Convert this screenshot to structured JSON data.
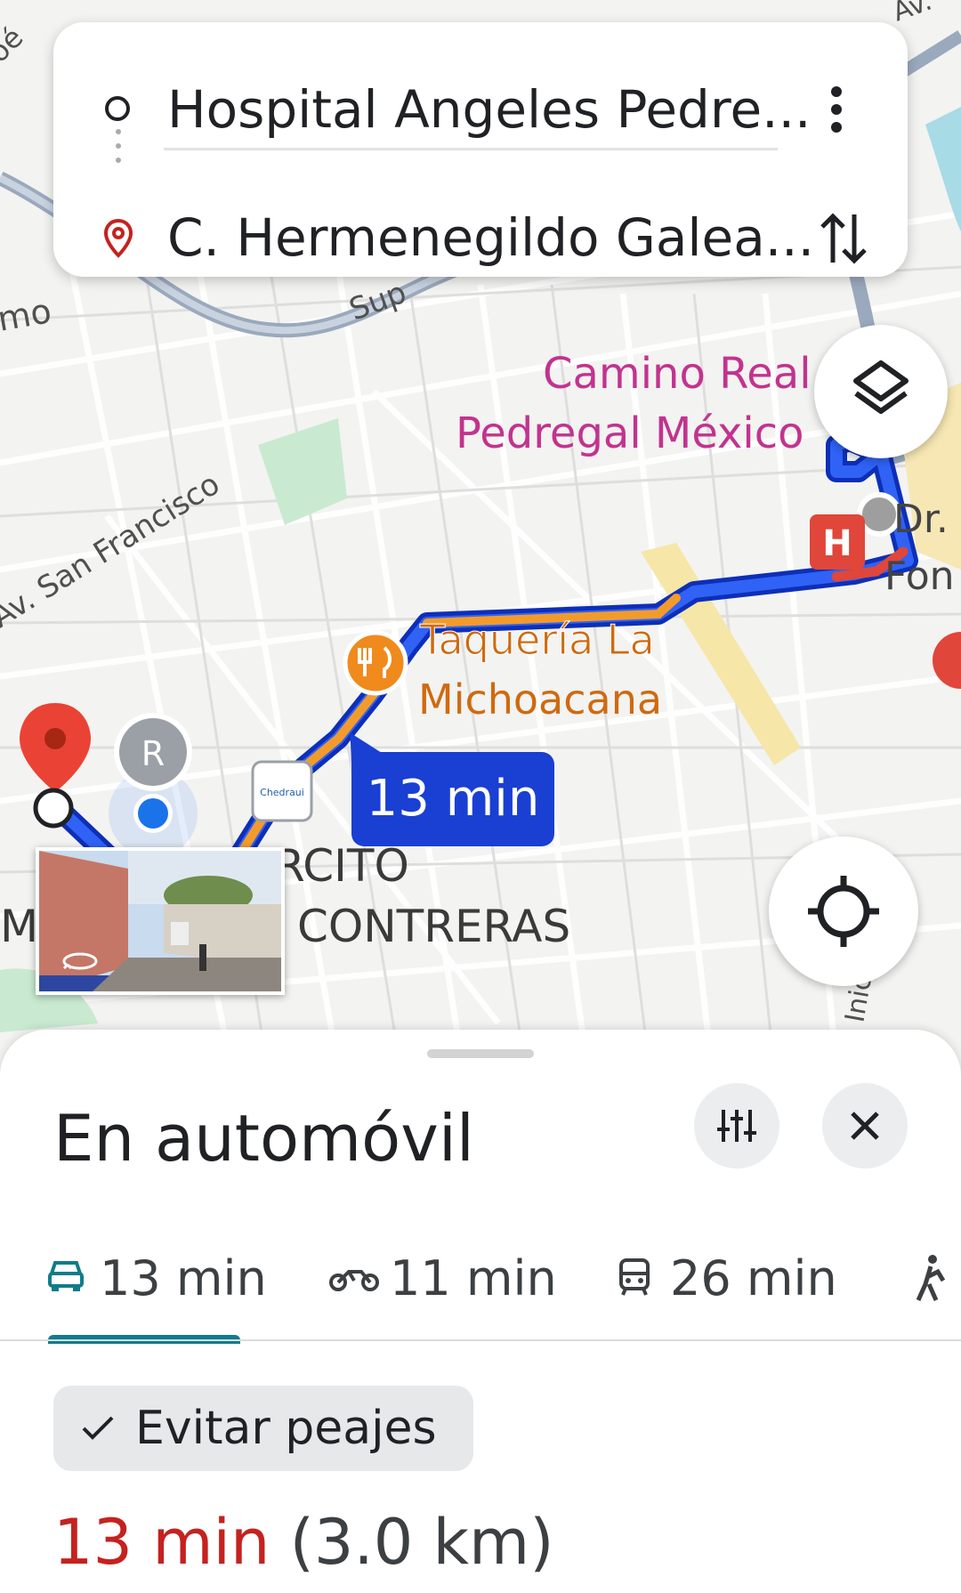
{
  "search": {
    "origin": "Hospital Angeles Pedre...",
    "destination": "C. Hermenegildo Galea..."
  },
  "map": {
    "road_labels": [
      "Av. San Francisco",
      "Sup",
      "mo",
      "oé",
      "Av.",
      "Inic"
    ],
    "poi_hotel": [
      "Camino Real",
      "Pedregal México"
    ],
    "poi_restaurant": [
      "Taquería La",
      "Michoacana"
    ],
    "area_labels": [
      "RCITO",
      "CONTRERAS",
      "M"
    ],
    "partial_labels": [
      "Dr. I",
      "Fon"
    ],
    "user_avatar_letter": "R",
    "store_logo": "Chedraui",
    "eta_bubble": "13 min",
    "colors": {
      "route": "#1a3fd3",
      "traffic": "#f29b2c",
      "jam": "#e0463a"
    }
  },
  "sheet": {
    "title": "En automóvil",
    "tabs": [
      {
        "mode": "car",
        "label": "13 min",
        "active": true
      },
      {
        "mode": "motorcycle",
        "label": "11 min",
        "active": false
      },
      {
        "mode": "transit",
        "label": "26 min",
        "active": false
      },
      {
        "mode": "walk",
        "label": "",
        "active": false
      }
    ],
    "chip_label": "Evitar peajes",
    "summary_time": "13 min",
    "summary_distance": "(3.0 km)"
  },
  "icons": [
    "origin-circle-icon",
    "destination-pin-icon",
    "more-vert-icon",
    "swap-icon",
    "layers-icon",
    "my-location-icon",
    "tune-icon",
    "close-icon",
    "car-icon",
    "motorcycle-icon",
    "transit-icon",
    "walk-icon",
    "check-icon",
    "hospital-icon",
    "restaurant-icon",
    "360-icon"
  ]
}
